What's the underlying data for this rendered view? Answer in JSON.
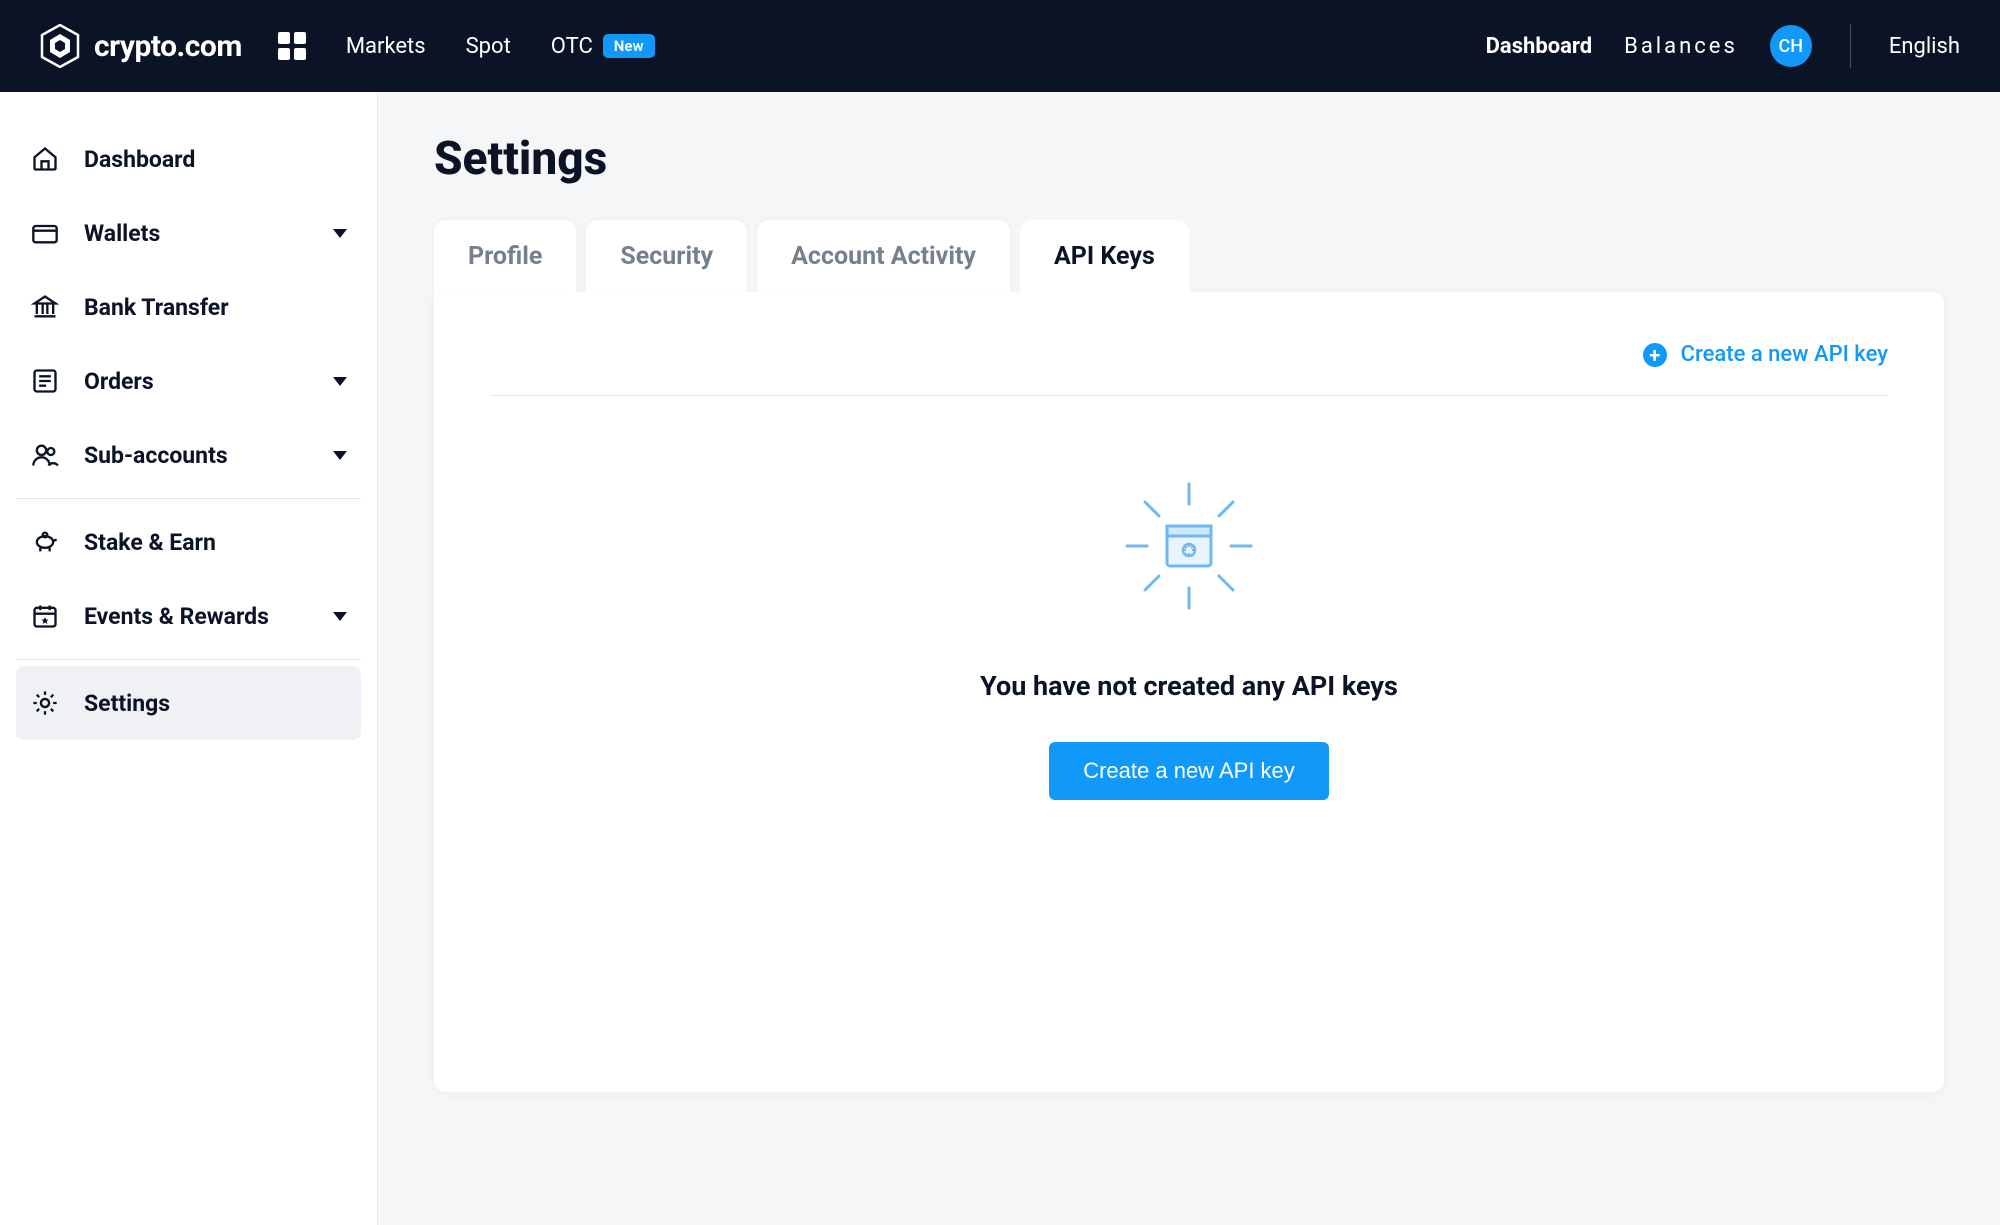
{
  "header": {
    "brand": "crypto.com",
    "nav": {
      "markets": "Markets",
      "spot": "Spot",
      "otc": "OTC",
      "new_badge": "New"
    },
    "right": {
      "dashboard": "Dashboard",
      "balances": "Balances",
      "avatar": "CH",
      "language": "English"
    }
  },
  "sidebar": {
    "items": [
      {
        "label": "Dashboard"
      },
      {
        "label": "Wallets"
      },
      {
        "label": "Bank Transfer"
      },
      {
        "label": "Orders"
      },
      {
        "label": "Sub-accounts"
      },
      {
        "label": "Stake & Earn"
      },
      {
        "label": "Events & Rewards"
      },
      {
        "label": "Settings"
      }
    ]
  },
  "page": {
    "title": "Settings"
  },
  "tabs": {
    "profile": "Profile",
    "security": "Security",
    "activity": "Account Activity",
    "apikeys": "API Keys"
  },
  "panel": {
    "create_link": "Create a new API key",
    "empty_title": "You have not created any API keys",
    "create_button": "Create a new API key"
  }
}
